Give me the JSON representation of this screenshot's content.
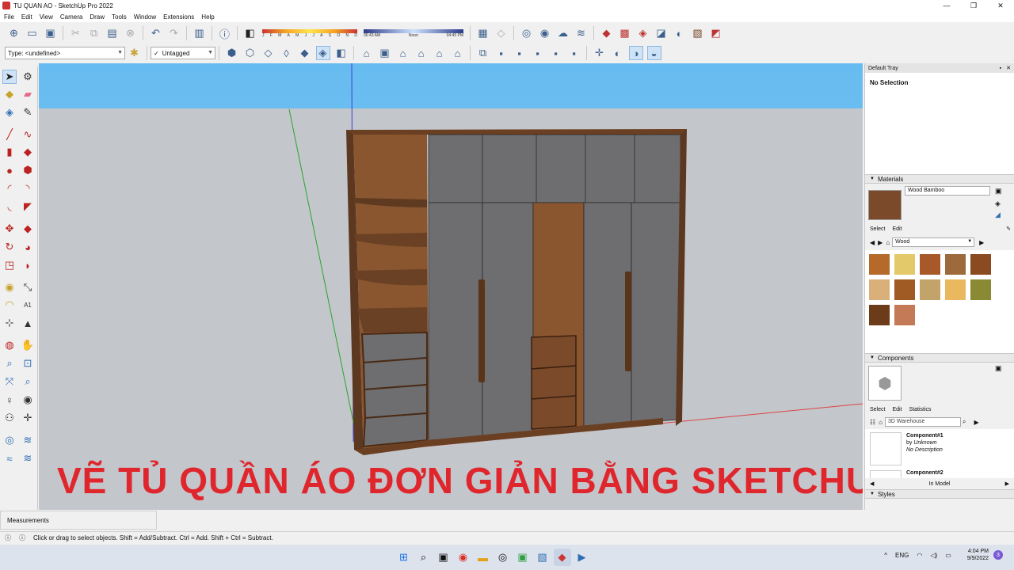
{
  "window": {
    "title": "TU QUAN AO - SketchUp Pro 2022",
    "controls": {
      "minimize": "—",
      "restore": "❐",
      "close": "✕"
    }
  },
  "menubar": {
    "items": [
      "File",
      "Edit",
      "View",
      "Camera",
      "Draw",
      "Tools",
      "Window",
      "Extensions",
      "Help"
    ]
  },
  "toolbar": {
    "shadow_months": [
      "J",
      "F",
      "M",
      "A",
      "M",
      "J",
      "J",
      "A",
      "S",
      "O",
      "N",
      "D"
    ],
    "time_start": "06:43 AM",
    "time_noon": "Noon",
    "time_end": "04:45 PM",
    "type_value": "Type: <undefined>",
    "tag_value": "Untagged",
    "tag_check": "✓"
  },
  "viewport": {
    "caption": "VẼ TỦ QUẦN ÁO ĐƠN GIẢN BẰNG SKETCHUP",
    "colors": {
      "sky": "#7ec8f3",
      "ground": "#c3c6cb",
      "wood": "#7a4a2a",
      "door": "#6e6e70",
      "caption": "#e0262d"
    }
  },
  "tray": {
    "title": "Default Tray",
    "entity_info": "No Selection",
    "materials": {
      "label": "Materials",
      "current": "Wood Bamboo",
      "tab_select": "Select",
      "tab_edit": "Edit",
      "library": "Wood",
      "swatch_colors": [
        "#b56a2c",
        "#e3c96a",
        "#a8592a",
        "#9c6a3b",
        "#8a4b20",
        "#d9b07a",
        "#a05a24",
        "#c2a46a",
        "#eab85e",
        "#8a8a35",
        "#6b3b1a",
        "#c47a56"
      ]
    },
    "components": {
      "label": "Components",
      "tab_select": "Select",
      "tab_edit": "Edit",
      "tab_statistics": "Statistics",
      "search_placeholder": "3D Warehouse",
      "items": [
        {
          "name": "Component#1",
          "by_prefix": "by",
          "author": "Unknown",
          "desc": "No Description"
        },
        {
          "name": "Component#2",
          "by_prefix": "",
          "author": "",
          "desc": ""
        }
      ],
      "footer": "In Model"
    },
    "styles": {
      "label": "Styles"
    }
  },
  "measurements": {
    "label": "Measurements"
  },
  "status": {
    "text": "Click or drag to select objects. Shift = Add/Subtract. Ctrl = Add. Shift + Ctrl = Subtract."
  },
  "taskbar": {
    "lang": "ENG",
    "time": "4:04 PM",
    "date": "9/9/2022",
    "notification_count": "3"
  }
}
